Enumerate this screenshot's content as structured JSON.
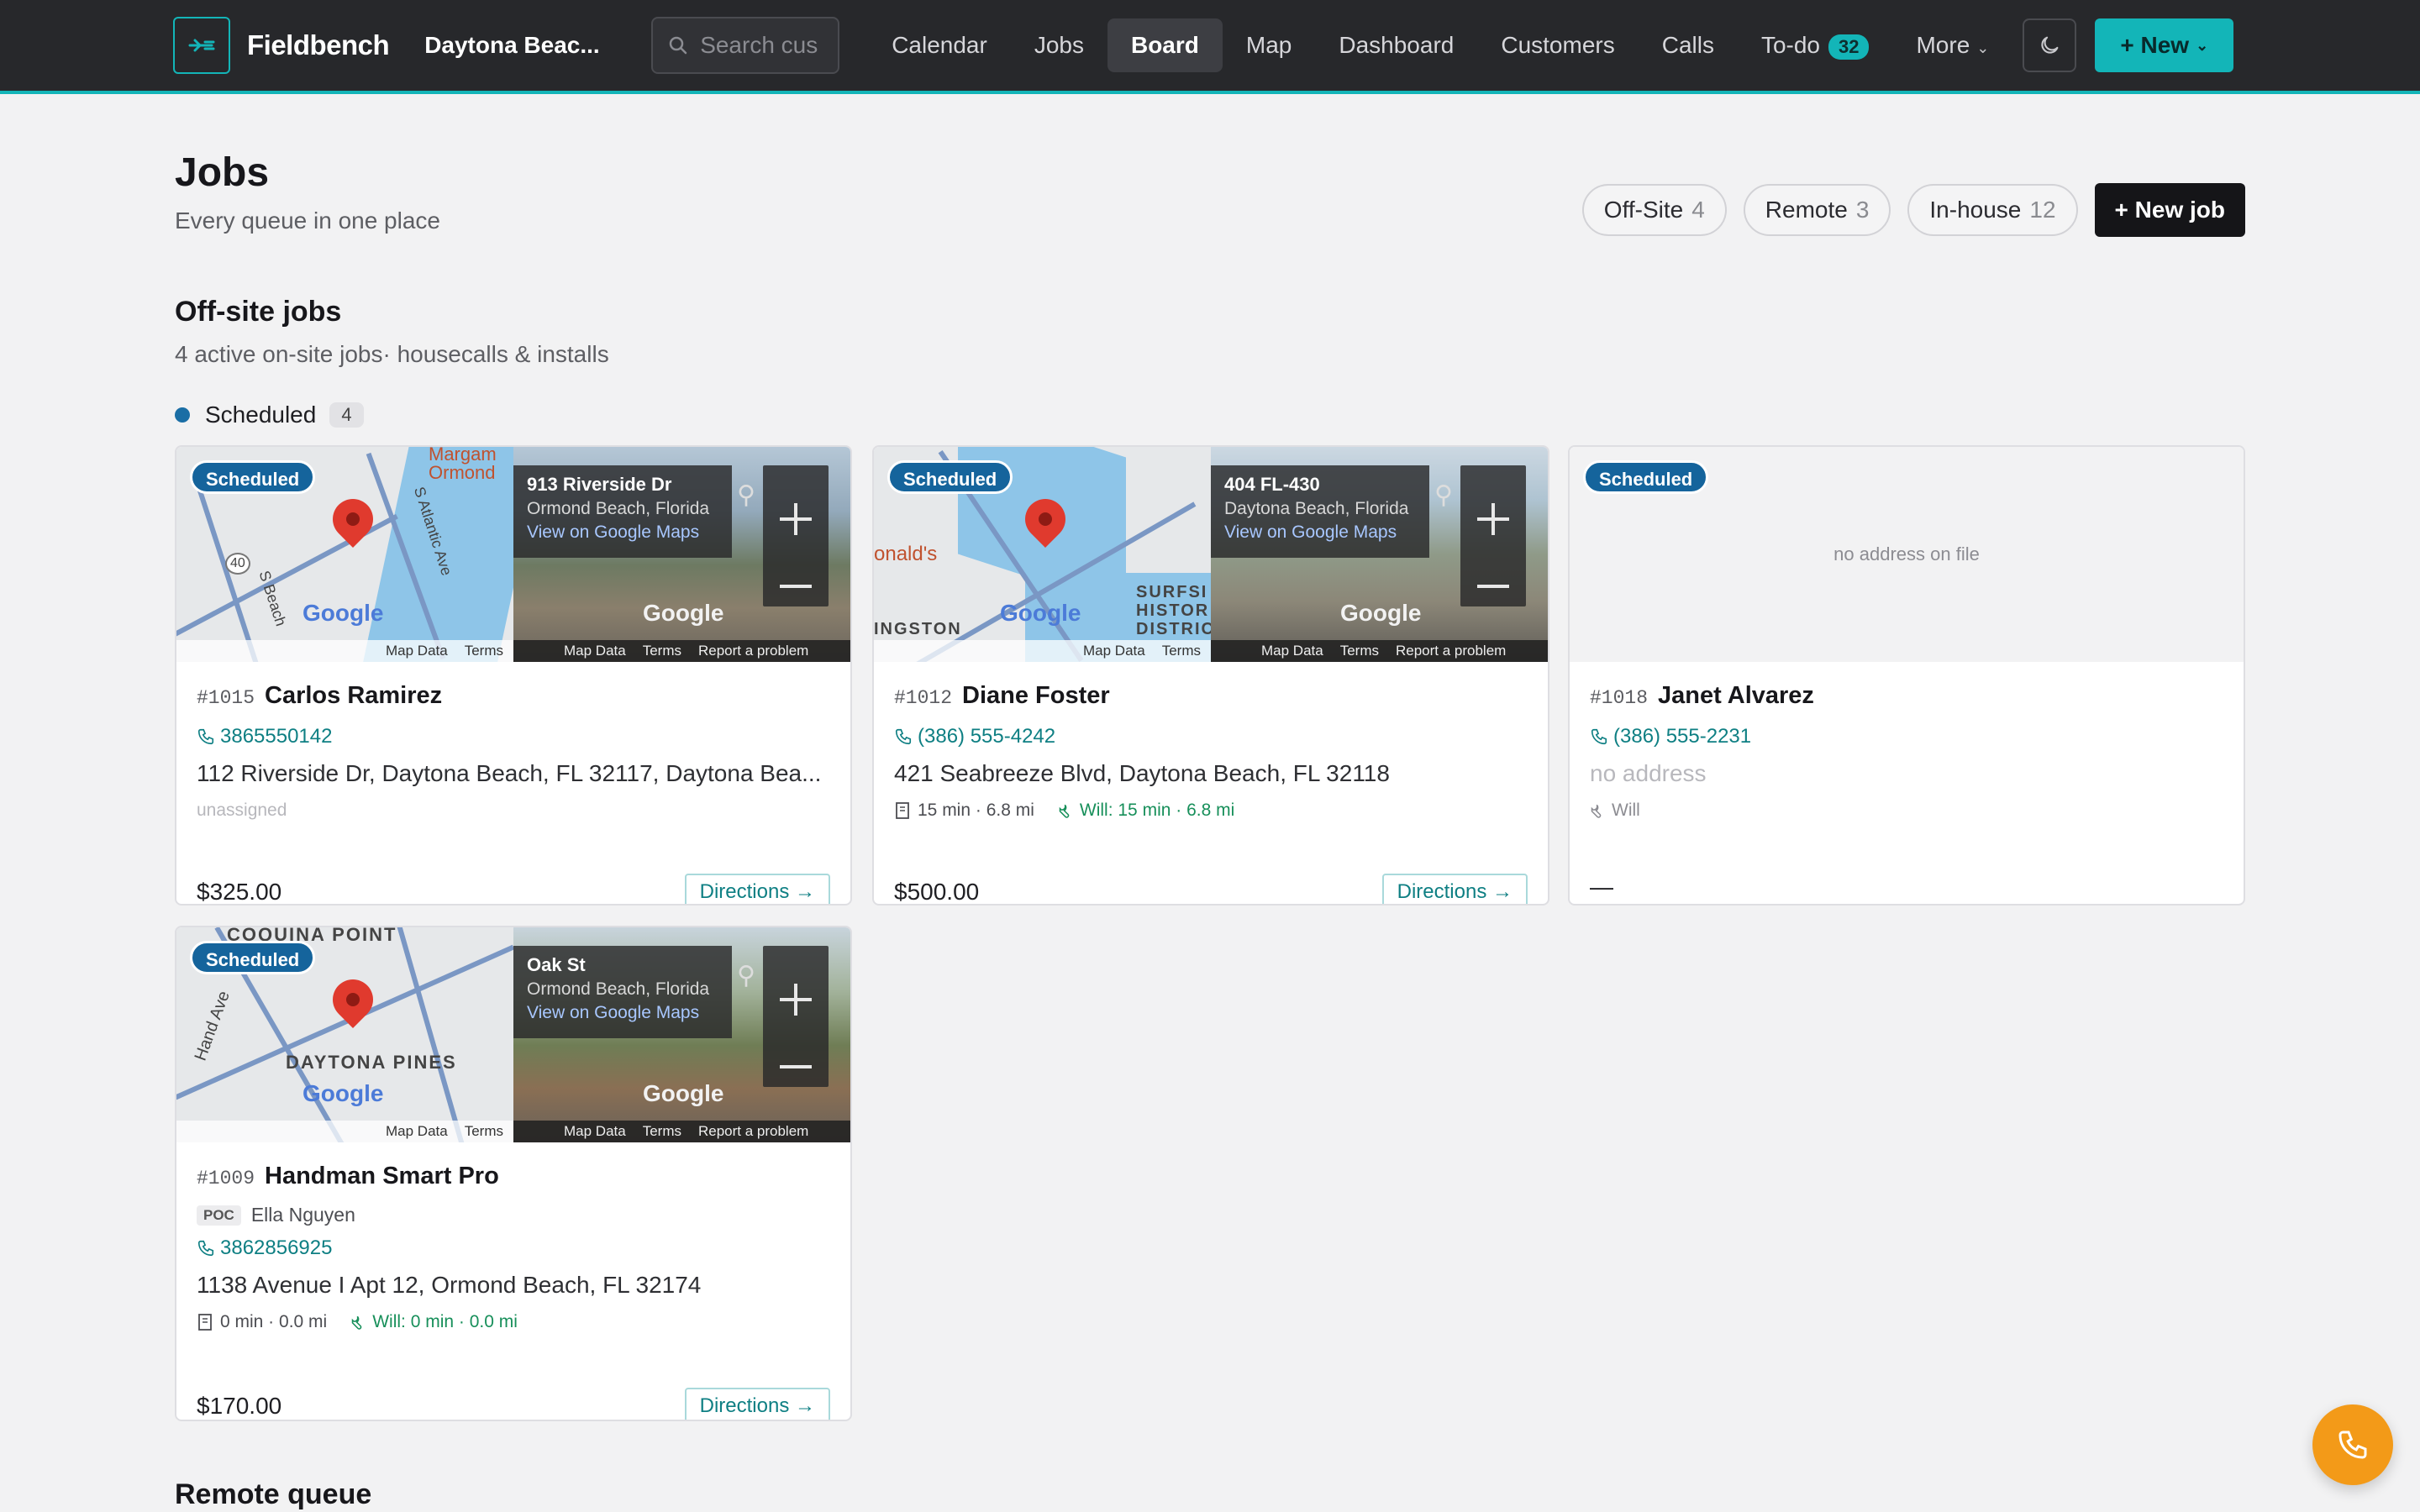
{
  "nav": {
    "brand": "Fieldbench",
    "location": "Daytona Beac...",
    "search_placeholder": "Search cus",
    "links": [
      "Calendar",
      "Jobs",
      "Board",
      "Map",
      "Dashboard",
      "Customers",
      "Calls",
      "To-do",
      "More"
    ],
    "active": "Board",
    "todo_count": "32",
    "new_label": "+ New"
  },
  "header": {
    "title": "Jobs",
    "subtitle": "Every queue in one place",
    "filters": [
      {
        "label": "Off-Site",
        "count": "4"
      },
      {
        "label": "Remote",
        "count": "3"
      },
      {
        "label": "In-house",
        "count": "12"
      }
    ],
    "new_job_label": "+ New job"
  },
  "offsite": {
    "title": "Off-site jobs",
    "subtitle": "4 active on-site jobs· housecalls & installs",
    "status_label": "Scheduled",
    "status_count": "4"
  },
  "map_chrome": {
    "map_data": "Map Data",
    "terms": "Terms",
    "report": "Report a problem",
    "google": "Google",
    "view_link": "View on Google Maps"
  },
  "jobs": [
    {
      "badge": "Scheduled",
      "number": "#1015",
      "name": "Carlos Ramirez",
      "phone": "3865550142",
      "address": "112 Riverside Dr, Daytona Beach, FL 32117, Daytona Bea...",
      "assignee": "unassigned",
      "price": "$325.00",
      "directions": "Directions →",
      "sv_address": "913 Riverside Dr",
      "sv_city": "Ormond Beach, Florida",
      "map_labels": [
        "Margam",
        "Ormond",
        "S Atlantic Ave",
        "S Beach",
        "40"
      ]
    },
    {
      "badge": "Scheduled",
      "number": "#1012",
      "name": "Diane Foster",
      "phone": "(386) 555-4242",
      "address": "421 Seabreeze Blvd, Daytona Beach, FL 32118",
      "drive": "15 min · 6.8 mi",
      "will": "Will: 15 min · 6.8 mi",
      "price": "$500.00",
      "directions": "Directions →",
      "sv_address": "404 FL-430",
      "sv_city": "Daytona Beach, Florida",
      "map_labels": [
        "onald's",
        "SURFSI",
        "HISTOR",
        "DISTRIC",
        "INGSTON"
      ]
    },
    {
      "badge": "Scheduled",
      "number": "#1018",
      "name": "Janet Alvarez",
      "phone": "(386) 555-2231",
      "address": "no address",
      "no_address_note": "no address on file",
      "will": "Will",
      "price": "—"
    },
    {
      "badge": "Scheduled",
      "number": "#1009",
      "name": "Handman Smart Pro",
      "poc_tag": "POC",
      "poc_name": "Ella Nguyen",
      "phone": "3862856925",
      "address": "1138 Avenue I Apt 12, Ormond Beach, FL 32174",
      "drive": "0 min · 0.0 mi",
      "will": "Will: 0 min · 0.0 mi",
      "price": "$170.00",
      "directions": "Directions →",
      "sv_address": "Oak St",
      "sv_city": "Ormond Beach, Florida",
      "map_labels": [
        "COQUINA POINT",
        "Hand Ave",
        "DAYTONA PINES"
      ]
    }
  ],
  "remote": {
    "title": "Remote queue"
  },
  "colors": {
    "accent": "#13b5b8",
    "status_scheduled": "#15649c",
    "fab": "#f39a18"
  }
}
